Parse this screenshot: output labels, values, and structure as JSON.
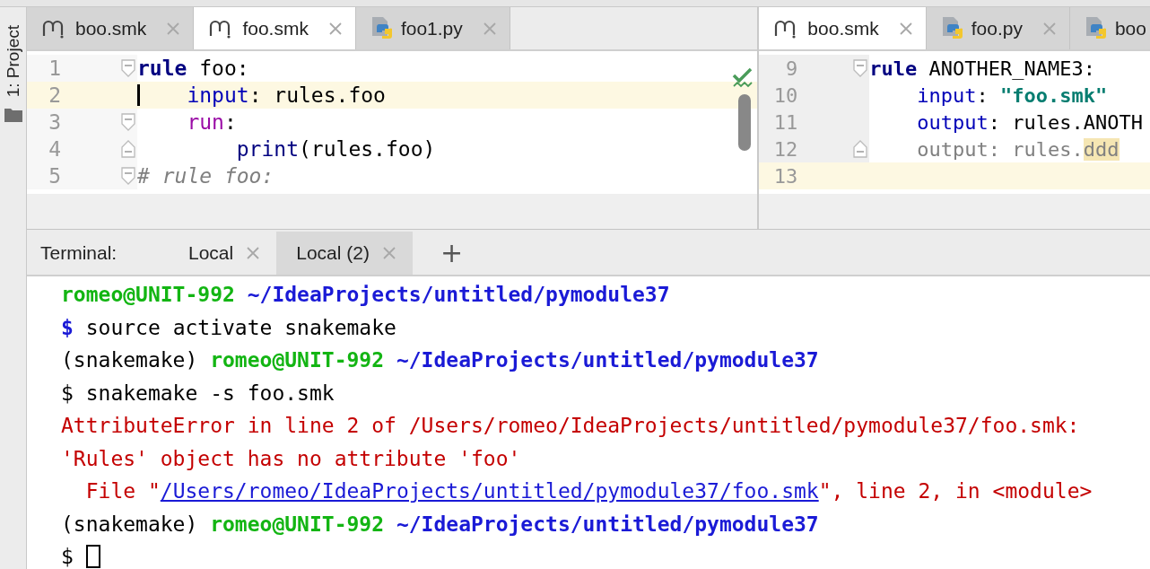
{
  "sidebar": {
    "label": "1: Project"
  },
  "editors": [
    {
      "tabs": [
        {
          "label": "boo.smk",
          "kind": "snakemake",
          "selected": false
        },
        {
          "label": "foo.smk",
          "kind": "snakemake",
          "selected": true
        },
        {
          "label": "foo1.py",
          "kind": "python",
          "selected": false
        }
      ],
      "inspection_ok": true,
      "lines": [
        {
          "number": "1",
          "fold_start": true,
          "fold_end": false,
          "current": false,
          "caret": false,
          "tokens": [
            {
              "kind": "keyword",
              "text": "rule"
            },
            {
              "kind": "plain",
              "text": " foo:"
            }
          ]
        },
        {
          "number": "2",
          "fold_start": false,
          "fold_end": false,
          "current": true,
          "caret": true,
          "tokens": [
            {
              "kind": "section",
              "text": "    input"
            },
            {
              "kind": "plain",
              "text": ": rules.foo"
            }
          ]
        },
        {
          "number": "3",
          "fold_start": true,
          "fold_end": false,
          "current": false,
          "caret": false,
          "tokens": [
            {
              "kind": "run",
              "text": "    run"
            },
            {
              "kind": "plain",
              "text": ":"
            }
          ]
        },
        {
          "number": "4",
          "fold_start": false,
          "fold_end": true,
          "current": false,
          "caret": false,
          "tokens": [
            {
              "kind": "builtin",
              "text": "        print"
            },
            {
              "kind": "plain",
              "text": "(rules.foo)"
            }
          ]
        },
        {
          "number": "5",
          "fold_start": true,
          "fold_end": false,
          "current": false,
          "caret": false,
          "tokens": [
            {
              "kind": "comment",
              "text": "# rule foo:"
            }
          ]
        }
      ]
    },
    {
      "tabs": [
        {
          "label": "boo.smk",
          "kind": "snakemake",
          "selected": true
        },
        {
          "label": "foo.py",
          "kind": "python",
          "selected": false
        },
        {
          "label": "boo",
          "kind": "python",
          "selected": false
        }
      ],
      "lines": [
        {
          "number": "9",
          "fold_start": true,
          "fold_end": false,
          "current": false,
          "caret": false,
          "tokens": [
            {
              "kind": "keyword",
              "text": "rule"
            },
            {
              "kind": "plain",
              "text": " ANOTHER_NAME3:"
            }
          ]
        },
        {
          "number": "10",
          "fold_start": false,
          "fold_end": false,
          "current": false,
          "caret": false,
          "tokens": [
            {
              "kind": "section",
              "text": "    input"
            },
            {
              "kind": "plain",
              "text": ": "
            },
            {
              "kind": "string",
              "text": "\"foo.smk\""
            }
          ]
        },
        {
          "number": "11",
          "fold_start": false,
          "fold_end": false,
          "current": false,
          "caret": false,
          "tokens": [
            {
              "kind": "section",
              "text": "    output"
            },
            {
              "kind": "plain",
              "text": ": rules.ANOTH"
            }
          ]
        },
        {
          "number": "12",
          "fold_start": false,
          "fold_end": true,
          "current": false,
          "caret": false,
          "tokens": [
            {
              "kind": "dim",
              "text": "    output: rules."
            },
            {
              "kind": "marked",
              "text": "ddd"
            }
          ]
        },
        {
          "number": "13",
          "fold_start": false,
          "fold_end": false,
          "current": true,
          "caret": false
        }
      ]
    }
  ],
  "terminal": {
    "title": "Terminal:",
    "tabs": [
      {
        "label": "Local",
        "selected": false
      },
      {
        "label": "Local (2)",
        "selected": true
      }
    ],
    "add_button": "+",
    "lines": [
      [
        {
          "kind": "user",
          "text": "romeo@UNIT-992"
        },
        {
          "kind": "path",
          "text": " ~/IdeaProjects/untitled/pymodule37"
        }
      ],
      [
        {
          "kind": "prompt",
          "text": "$"
        },
        {
          "kind": "plain",
          "text": " source activate snakemake"
        }
      ],
      [
        {
          "kind": "plain",
          "text": "(snakemake) "
        },
        {
          "kind": "user",
          "text": "romeo@UNIT-992"
        },
        {
          "kind": "path",
          "text": " ~/IdeaProjects/untitled/pymodule37"
        }
      ],
      [
        {
          "kind": "plain",
          "text": "$ snakemake -s foo.smk"
        }
      ],
      [
        {
          "kind": "error",
          "text": "AttributeError in line 2 of /Users/romeo/IdeaProjects/untitled/pymodule37/foo.smk:"
        }
      ],
      [
        {
          "kind": "error",
          "text": "'Rules' object has no attribute 'foo'"
        }
      ],
      [
        {
          "kind": "error",
          "text": "  File \""
        },
        {
          "kind": "link",
          "text": "/Users/romeo/IdeaProjects/untitled/pymodule37/foo.smk"
        },
        {
          "kind": "error",
          "text": "\", line 2, in <module>"
        }
      ],
      [
        {
          "kind": "plain",
          "text": "(snakemake) "
        },
        {
          "kind": "user",
          "text": "romeo@UNIT-992"
        },
        {
          "kind": "path",
          "text": " ~/IdeaProjects/untitled/pymodule37"
        }
      ],
      [
        {
          "kind": "plain",
          "text": "$ "
        },
        {
          "kind": "cursor"
        }
      ]
    ]
  }
}
